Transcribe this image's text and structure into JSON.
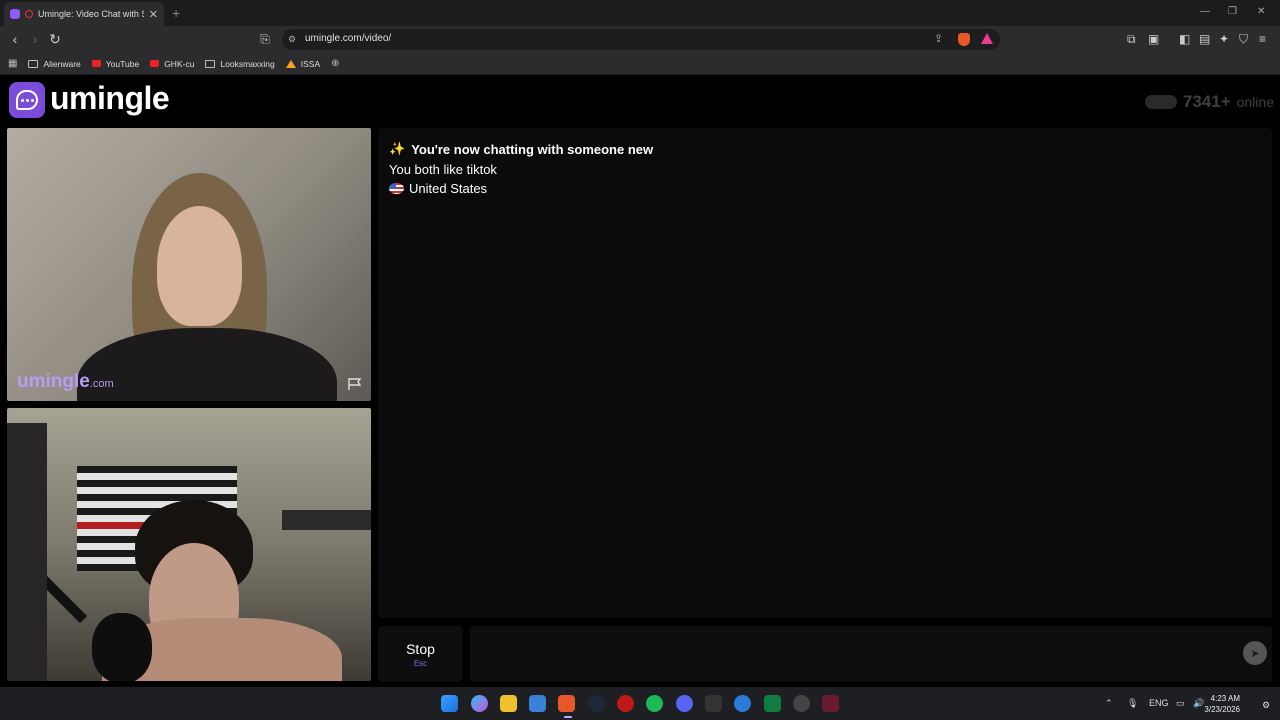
{
  "browser": {
    "tab_title": "Umingle: Video Chat with Stra",
    "new_tab": "+",
    "url": "umingle.com/video/",
    "bookmarks": [
      {
        "label": "Alienware",
        "icon": "folder-icon"
      },
      {
        "label": "YouTube",
        "icon": "youtube-icon"
      },
      {
        "label": "GHK-cu",
        "icon": "youtube-icon"
      },
      {
        "label": "Looksmaxxing",
        "icon": "folder-icon"
      },
      {
        "label": "ISSA",
        "icon": "issa-icon"
      }
    ]
  },
  "site": {
    "logo_text": "umingle",
    "online_count": "7341+",
    "online_label": "online"
  },
  "stranger_video": {
    "watermark": "umingle",
    "watermark_suffix": ".com"
  },
  "chat": {
    "sparkle": "✨",
    "status": "You're now chatting with someone new",
    "interest": "You both like tiktok",
    "country": "United States"
  },
  "controls": {
    "stop_label": "Stop",
    "stop_key": "Esc"
  },
  "taskbar": {
    "lang": "ENG",
    "time": "4:23 AM",
    "date": "3/23/2026"
  },
  "colors": {
    "accent": "#7b4cd8",
    "watermark": "#b79cf5",
    "background": "#000000"
  }
}
